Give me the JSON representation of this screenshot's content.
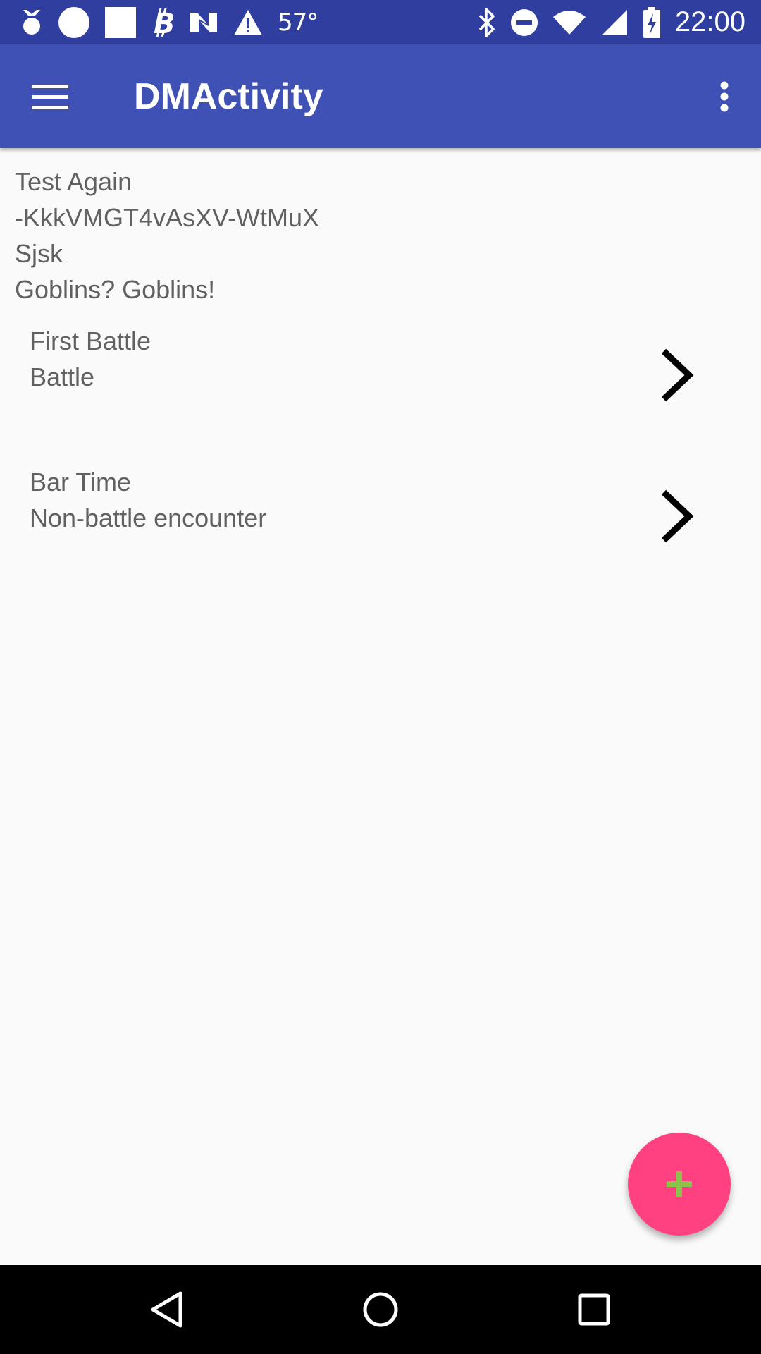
{
  "status_bar": {
    "temperature": "57°",
    "time": "22:00",
    "left_icons": [
      "medal-icon",
      "circle-icon",
      "square-icon",
      "bitcoin-icon",
      "n-logo-icon",
      "warning-icon"
    ],
    "right_icons": [
      "bluetooth-icon",
      "do-not-disturb-icon",
      "wifi-icon",
      "signal-icon",
      "battery-charging-icon"
    ]
  },
  "app_bar": {
    "title": "DMActivity",
    "background": "#3f51b5",
    "status_background": "#303f9f"
  },
  "campaign": {
    "name": "Test Again",
    "id": "-KkkVMGT4vAsXV-WtMuX",
    "line3": "Sjsk",
    "line4": "Goblins? Goblins!"
  },
  "encounters": [
    {
      "name": "First Battle",
      "type": "Battle"
    },
    {
      "name": "Bar Time",
      "type": "Non-battle encounter"
    }
  ],
  "fab": {
    "icon": "plus-icon",
    "background": "#ff4081",
    "icon_color": "#8bc34a"
  },
  "nav_bar": {
    "buttons": [
      "back-icon",
      "home-icon",
      "recents-icon"
    ]
  }
}
